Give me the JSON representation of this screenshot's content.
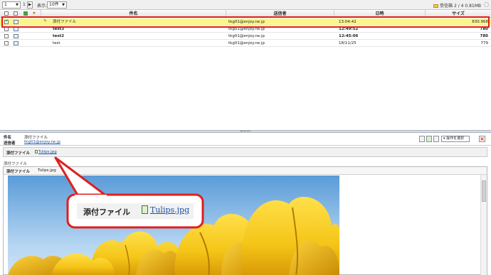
{
  "toolbar": {
    "page_current": "1",
    "page_total": "1",
    "display_label": "表示:",
    "per_page": "10件",
    "folder_name": "受信箱",
    "folder_stats": "2 / 4  0.81MB"
  },
  "list_header": {
    "subject": "件名",
    "sender": "送信者",
    "date": "日時",
    "size": "サイズ"
  },
  "mails": [
    {
      "subject": "添付ファイル",
      "sender": "tkg01@enjoy.ne.jp",
      "date": "13:04:42",
      "size": "830.968",
      "selected": true,
      "attachment": true
    },
    {
      "subject": "test3",
      "sender": "tkg01@enjoy.ne.jp",
      "date": "12:49:52",
      "size": "780",
      "selected": false,
      "attachment": false
    },
    {
      "subject": "test2",
      "sender": "tkg01@enjoy.ne.jp",
      "date": "12:45:06",
      "size": "780",
      "selected": false,
      "attachment": false
    },
    {
      "subject": "test",
      "sender": "tkg01@enjoy.ne.jp",
      "date": "18/11/25",
      "size": "779",
      "selected": false,
      "attachment": false
    }
  ],
  "preview": {
    "subject_label": "件名",
    "subject_value": "添付ファイル",
    "sender_label": "送信者",
    "sender_value": "tkg01@enjoy.ne.jp",
    "action_select": "操作を選択",
    "attach_label": "添付ファイル",
    "attach_file": "Tulips.jpg",
    "section_title": "添付ファイル",
    "frame_label": "添付ファイル",
    "frame_file": "Tulips.jpg"
  },
  "callout": {
    "label": "添付ファイル",
    "file": "Tulips.jpg"
  },
  "colors": {
    "selected_row": "#fbf68a",
    "highlight_border": "#e01e1e",
    "link": "#1a4fa3",
    "tulip_yellow": "#f5c518"
  }
}
